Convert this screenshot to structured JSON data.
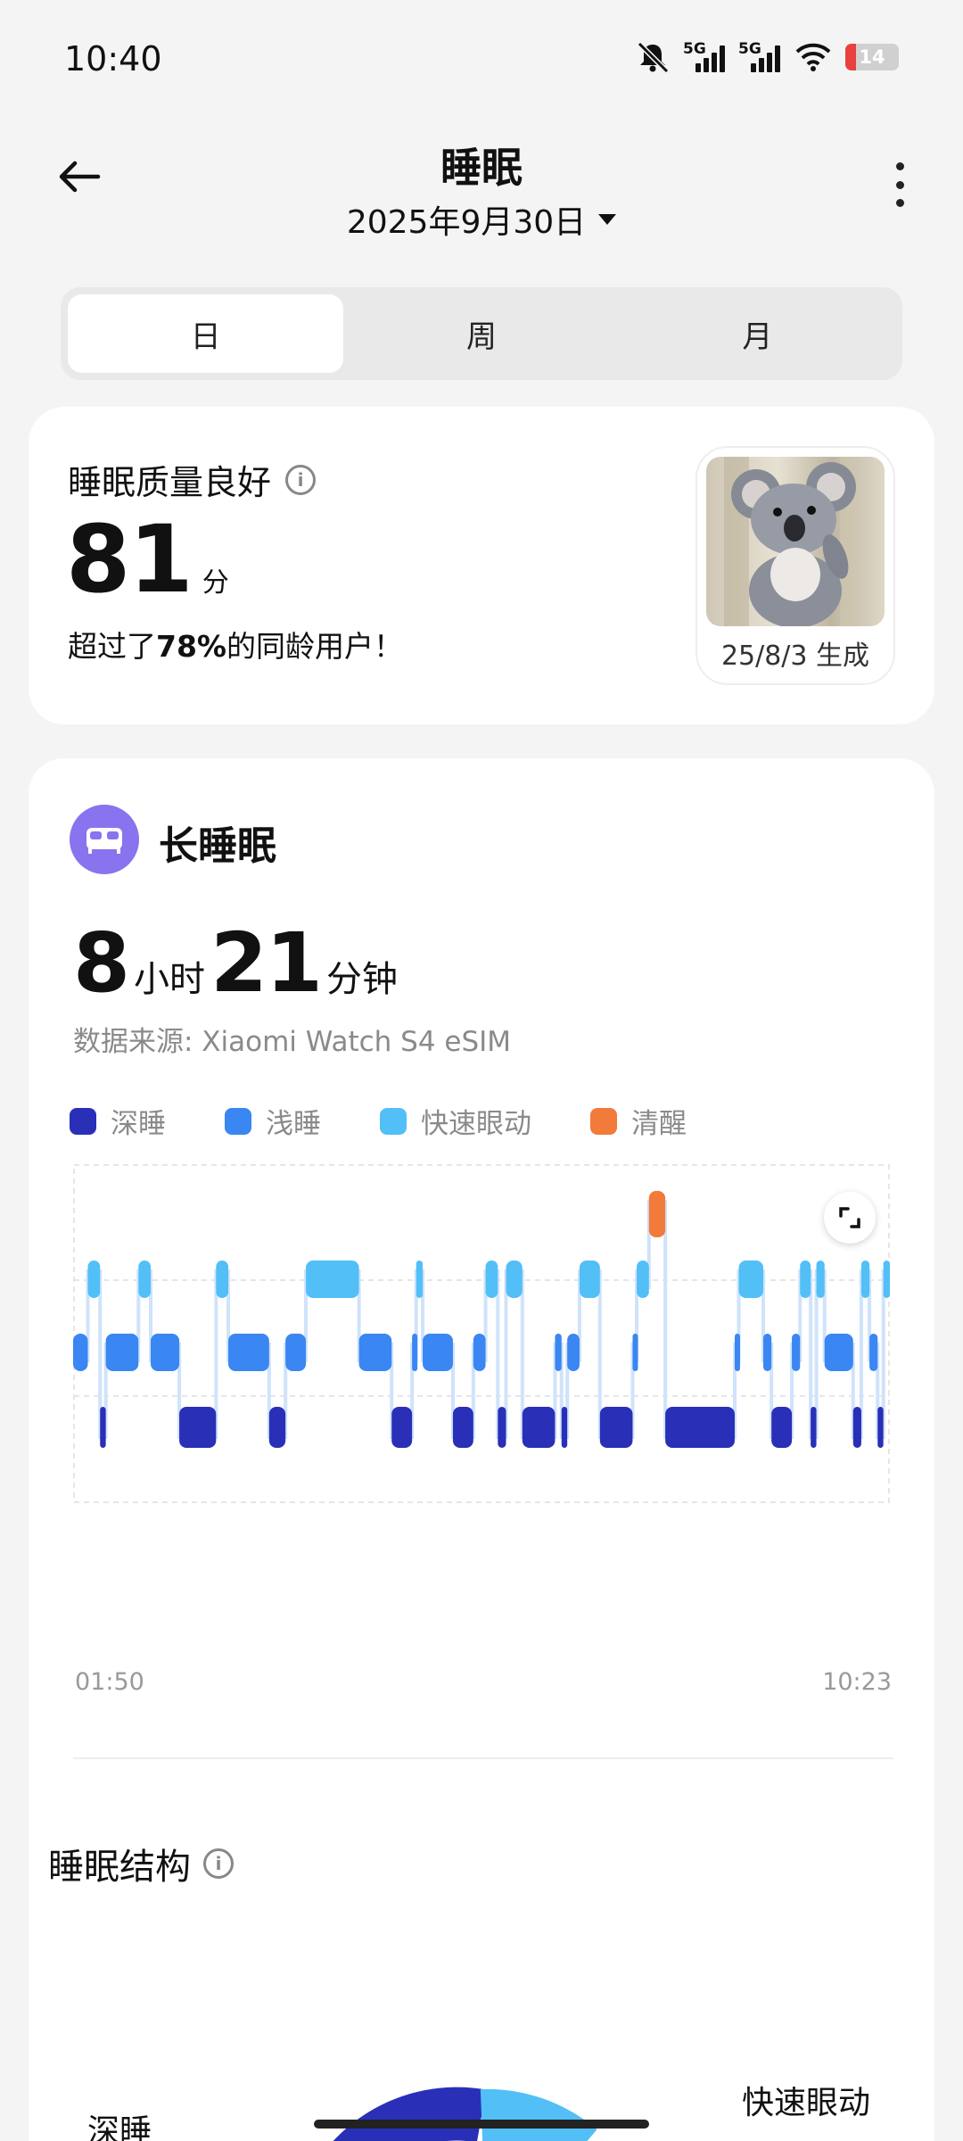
{
  "status_bar": {
    "time": "10:40",
    "battery": "14",
    "net1": "5G",
    "net2": "5G",
    "icons": [
      "mute-icon",
      "signal-icon",
      "signal-icon",
      "wifi-icon",
      "battery-icon"
    ]
  },
  "header": {
    "title": "睡眠",
    "date": "2025年9月30日"
  },
  "tabs": [
    {
      "label": "日",
      "active": true
    },
    {
      "label": "周",
      "active": false
    },
    {
      "label": "月",
      "active": false
    }
  ],
  "quality": {
    "label": "睡眠质量良好",
    "score": "81",
    "score_unit": "分",
    "compare_prefix": "超过了",
    "compare_value": "78%",
    "compare_suffix": "的同龄用户！",
    "avatar_date": "25/8/3 生成"
  },
  "sleep": {
    "type": "长睡眠",
    "hours": "8",
    "hours_unit": "小时",
    "minutes": "21",
    "minutes_unit": "分钟",
    "source": "数据来源: Xiaomi Watch S4 eSIM",
    "legend": [
      {
        "label": "深睡",
        "color": "#2a2fb8"
      },
      {
        "label": "浅睡",
        "color": "#3a86f2"
      },
      {
        "label": "快速眼动",
        "color": "#52bff7"
      },
      {
        "label": "清醒",
        "color": "#f27a3a"
      }
    ],
    "start_time": "01:50",
    "end_time": "10:23"
  },
  "chart_data": {
    "type": "hypnogram",
    "stages": [
      "清醒",
      "快速眼动",
      "浅睡",
      "深睡"
    ],
    "x_range": [
      "01:50",
      "10:23"
    ],
    "segments": [
      {
        "stage": "浅睡",
        "start": 0.0,
        "end": 0.018
      },
      {
        "stage": "快速眼动",
        "start": 0.018,
        "end": 0.033
      },
      {
        "stage": "深睡",
        "start": 0.033,
        "end": 0.04
      },
      {
        "stage": "浅睡",
        "start": 0.04,
        "end": 0.08
      },
      {
        "stage": "快速眼动",
        "start": 0.08,
        "end": 0.095
      },
      {
        "stage": "浅睡",
        "start": 0.095,
        "end": 0.13
      },
      {
        "stage": "深睡",
        "start": 0.13,
        "end": 0.175
      },
      {
        "stage": "快速眼动",
        "start": 0.175,
        "end": 0.19
      },
      {
        "stage": "浅睡",
        "start": 0.19,
        "end": 0.24
      },
      {
        "stage": "深睡",
        "start": 0.24,
        "end": 0.26
      },
      {
        "stage": "浅睡",
        "start": 0.26,
        "end": 0.285
      },
      {
        "stage": "快速眼动",
        "start": 0.285,
        "end": 0.35
      },
      {
        "stage": "浅睡",
        "start": 0.35,
        "end": 0.39
      },
      {
        "stage": "深睡",
        "start": 0.39,
        "end": 0.415
      },
      {
        "stage": "浅睡",
        "start": 0.415,
        "end": 0.42
      },
      {
        "stage": "快速眼动",
        "start": 0.42,
        "end": 0.428
      },
      {
        "stage": "浅睡",
        "start": 0.428,
        "end": 0.465
      },
      {
        "stage": "深睡",
        "start": 0.465,
        "end": 0.49
      },
      {
        "stage": "浅睡",
        "start": 0.49,
        "end": 0.505
      },
      {
        "stage": "快速眼动",
        "start": 0.505,
        "end": 0.52
      },
      {
        "stage": "深睡",
        "start": 0.52,
        "end": 0.53
      },
      {
        "stage": "快速眼动",
        "start": 0.53,
        "end": 0.55
      },
      {
        "stage": "深睡",
        "start": 0.55,
        "end": 0.59
      },
      {
        "stage": "浅睡",
        "start": 0.59,
        "end": 0.598
      },
      {
        "stage": "深睡",
        "start": 0.598,
        "end": 0.605
      },
      {
        "stage": "浅睡",
        "start": 0.605,
        "end": 0.62
      },
      {
        "stage": "快速眼动",
        "start": 0.62,
        "end": 0.645
      },
      {
        "stage": "深睡",
        "start": 0.645,
        "end": 0.685
      },
      {
        "stage": "浅睡",
        "start": 0.685,
        "end": 0.69
      },
      {
        "stage": "快速眼动",
        "start": 0.69,
        "end": 0.705
      },
      {
        "stage": "清醒",
        "start": 0.705,
        "end": 0.725
      },
      {
        "stage": "深睡",
        "start": 0.725,
        "end": 0.81
      },
      {
        "stage": "浅睡",
        "start": 0.81,
        "end": 0.815
      },
      {
        "stage": "快速眼动",
        "start": 0.815,
        "end": 0.845
      },
      {
        "stage": "浅睡",
        "start": 0.845,
        "end": 0.855
      },
      {
        "stage": "深睡",
        "start": 0.855,
        "end": 0.88
      },
      {
        "stage": "浅睡",
        "start": 0.88,
        "end": 0.89
      },
      {
        "stage": "快速眼动",
        "start": 0.89,
        "end": 0.903
      },
      {
        "stage": "深睡",
        "start": 0.903,
        "end": 0.91
      },
      {
        "stage": "快速眼动",
        "start": 0.91,
        "end": 0.92
      },
      {
        "stage": "浅睡",
        "start": 0.92,
        "end": 0.955
      },
      {
        "stage": "深睡",
        "start": 0.955,
        "end": 0.965
      },
      {
        "stage": "快速眼动",
        "start": 0.965,
        "end": 0.975
      },
      {
        "stage": "浅睡",
        "start": 0.975,
        "end": 0.985
      },
      {
        "stage": "深睡",
        "start": 0.985,
        "end": 0.992
      },
      {
        "stage": "快速眼动",
        "start": 0.992,
        "end": 1.0
      }
    ]
  },
  "structure": {
    "title": "睡眠结构",
    "label_left": "深睡",
    "label_right": "快速眼动"
  }
}
